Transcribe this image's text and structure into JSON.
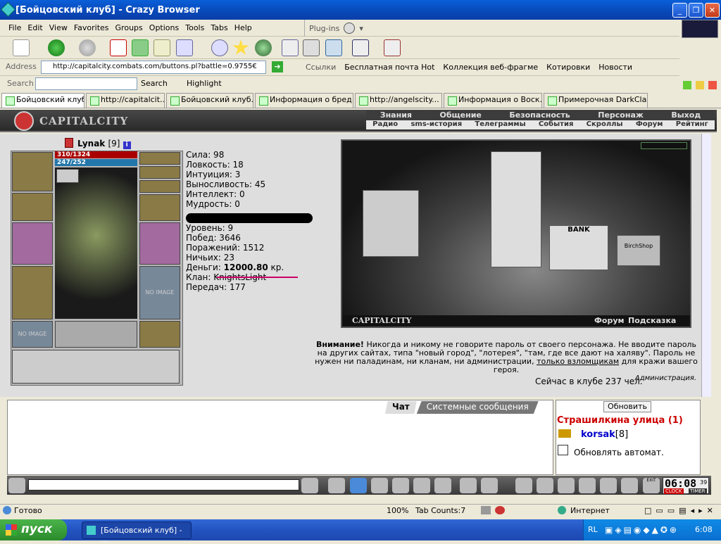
{
  "window": {
    "title": "[Бойцовский клуб] - Crazy Browser"
  },
  "menu": [
    "File",
    "Edit",
    "View",
    "Favorites",
    "Groups",
    "Options",
    "Tools",
    "Tabs",
    "Help"
  ],
  "plugins_label": "Plug-ins",
  "address": {
    "label": "Address",
    "url": "http://capitalcity.combats.com/buttons.pl?battle=0.9755€"
  },
  "links": {
    "label": "Ссылки",
    "items": [
      "Бесплатная почта Hot",
      "Коллекция веб-фрагме",
      "Котировки",
      "Новости"
    ]
  },
  "search": {
    "label": "Search",
    "button": "Search",
    "highlight": "Highlight"
  },
  "tabs": [
    "Бойцовский клуб",
    "http://capitalcit...",
    "Бойцовский клуб. ...",
    "Информация о бред...",
    "http://angelscity...",
    "Информация о Воск...",
    "Примерочная DarkClan"
  ],
  "game": {
    "logo": "CAPITALCITY",
    "nav1": [
      "Знания",
      "Общение",
      "Безопасность",
      "Персонаж",
      "Выход"
    ],
    "nav2": [
      "Радио",
      "sms-история",
      "Телеграммы",
      "События",
      "Скроллы",
      "Форум",
      "Рейтинг"
    ],
    "char_name": "Lynak",
    "char_level": "[9]",
    "hp": "310/1324",
    "mana": "247/252",
    "no_image": "NO IMAGE",
    "stats": {
      "str": "Сила: 98",
      "agi": "Ловкость: 18",
      "int": "Интуиция: 3",
      "end": "Выносливость: 45",
      "intel": "Интеллект: 0",
      "wis": "Мудрость: 0",
      "level": "Уровень: 9",
      "wins": "Побед: 3646",
      "losses": "Поражений: 1512",
      "draws": "Ничьих: 23",
      "money_label": "Деньги:",
      "money": "12000.80",
      "money_unit": "кр.",
      "clan": "Клан: KnightsLight",
      "transfers": "Передач: 177"
    },
    "scene": {
      "label": "CAPITALCITY",
      "forum": "Форум",
      "hint": "Подсказка",
      "bank": "BANK",
      "shop": "BirchShop"
    },
    "warning": {
      "bold": "Внимание!",
      "text": "Никогда и никому не говорите пароль от своего персонажа. Не вводите пароль на других сайтах, типа \"новый город\", \"лотерея\", \"там, где все дают на халяву\". Пароль не нужен ни паладинам, ни кланам, ни администрации,",
      "link": "только взломщикам",
      "tail": "для кражи вашего героя.",
      "sign": "Администрация."
    },
    "online": "Сейчас в клубе 237 чел.",
    "chat_tabs": [
      "Чат",
      "Системные сообщения"
    ],
    "refresh": "Обновить",
    "location": "Страшилкина улица (1)",
    "user": "korsak",
    "user_level": "[8]",
    "auto_refresh": "Обновлять автомат.",
    "clock": "06:08",
    "clock_sec": "39",
    "clock_label": "CLOCK",
    "timer_label": "TIMER",
    "exit": "EXIT"
  },
  "status": {
    "ready": "Готово",
    "zoom": "100%",
    "tab_counts": "Tab Counts:7",
    "zone": "Интернет"
  },
  "taskbar": {
    "start": "пуск",
    "item": "[Бойцовский клуб] - ...",
    "lang": "RL",
    "time": "6:08"
  }
}
